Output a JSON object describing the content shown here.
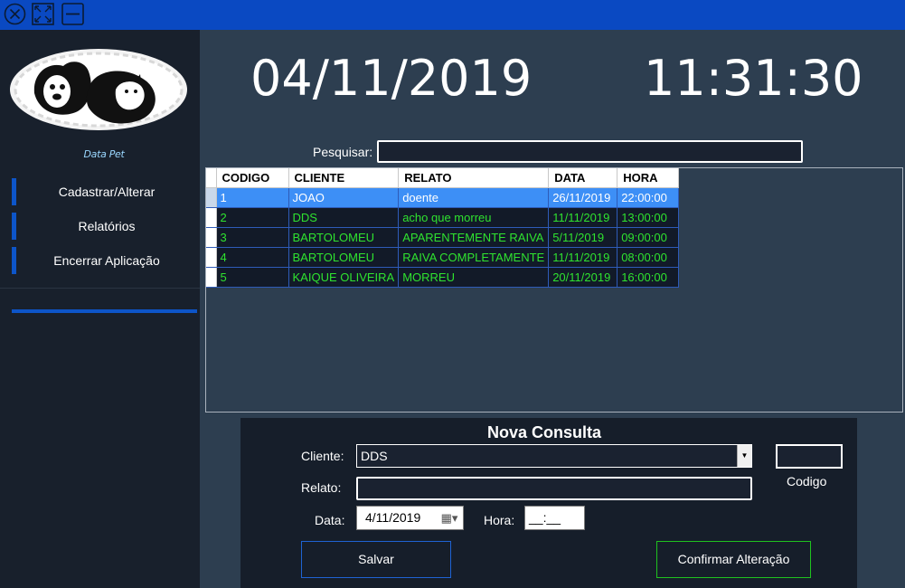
{
  "titlebar": {
    "icons": [
      "close-circle-icon",
      "resize-icon",
      "minimize-icon"
    ]
  },
  "sidebar": {
    "logo_caption": "Data Pet",
    "items": [
      {
        "label": "Cadastrar/Alterar"
      },
      {
        "label": "Relatórios"
      },
      {
        "label": "Encerrar Aplicação"
      }
    ]
  },
  "header": {
    "date": "04/11/2019",
    "time": "11:31:30"
  },
  "search": {
    "label": "Pesquisar:",
    "value": ""
  },
  "grid": {
    "columns": [
      "CODIGO",
      "CLIENTE",
      "RELATO",
      "DATA",
      "HORA"
    ],
    "rows": [
      {
        "codigo": "1",
        "cliente": "JOAO",
        "relato": "doente",
        "data": "26/11/2019",
        "hora": "22:00:00"
      },
      {
        "codigo": "2",
        "cliente": "DDS",
        "relato": "acho que morreu",
        "data": "11/11/2019",
        "hora": "13:00:00"
      },
      {
        "codigo": "3",
        "cliente": "BARTOLOMEU",
        "relato": "APARENTEMENTE RAIVA",
        "data": "5/11/2019",
        "hora": "09:00:00"
      },
      {
        "codigo": "4",
        "cliente": "BARTOLOMEU",
        "relato": "RAIVA COMPLETAMENTE",
        "data": "11/11/2019",
        "hora": "08:00:00"
      },
      {
        "codigo": "5",
        "cliente": "KAIQUE OLIVEIRA",
        "relato": "MORREU",
        "data": "20/11/2019",
        "hora": "16:00:00"
      }
    ],
    "selected_row": 0
  },
  "form": {
    "title": "Nova Consulta",
    "cliente_label": "Cliente:",
    "cliente_value": "DDS",
    "codigo_label": "Codigo",
    "codigo_value": "",
    "relato_label": "Relato:",
    "relato_value": "",
    "data_label": "Data:",
    "data_value": "4/11/2019",
    "hora_label": "Hora:",
    "hora_value": "__:__",
    "salvar_label": "Salvar",
    "confirmar_label": "Confirmar Alteração"
  },
  "colors": {
    "titlebar": "#0a49c2",
    "sidebar": "#18202c",
    "main": "#2d3e50",
    "accent": "#0d55c9",
    "grid_text": "#2fe32f",
    "selected_row": "#3d8ff6"
  }
}
